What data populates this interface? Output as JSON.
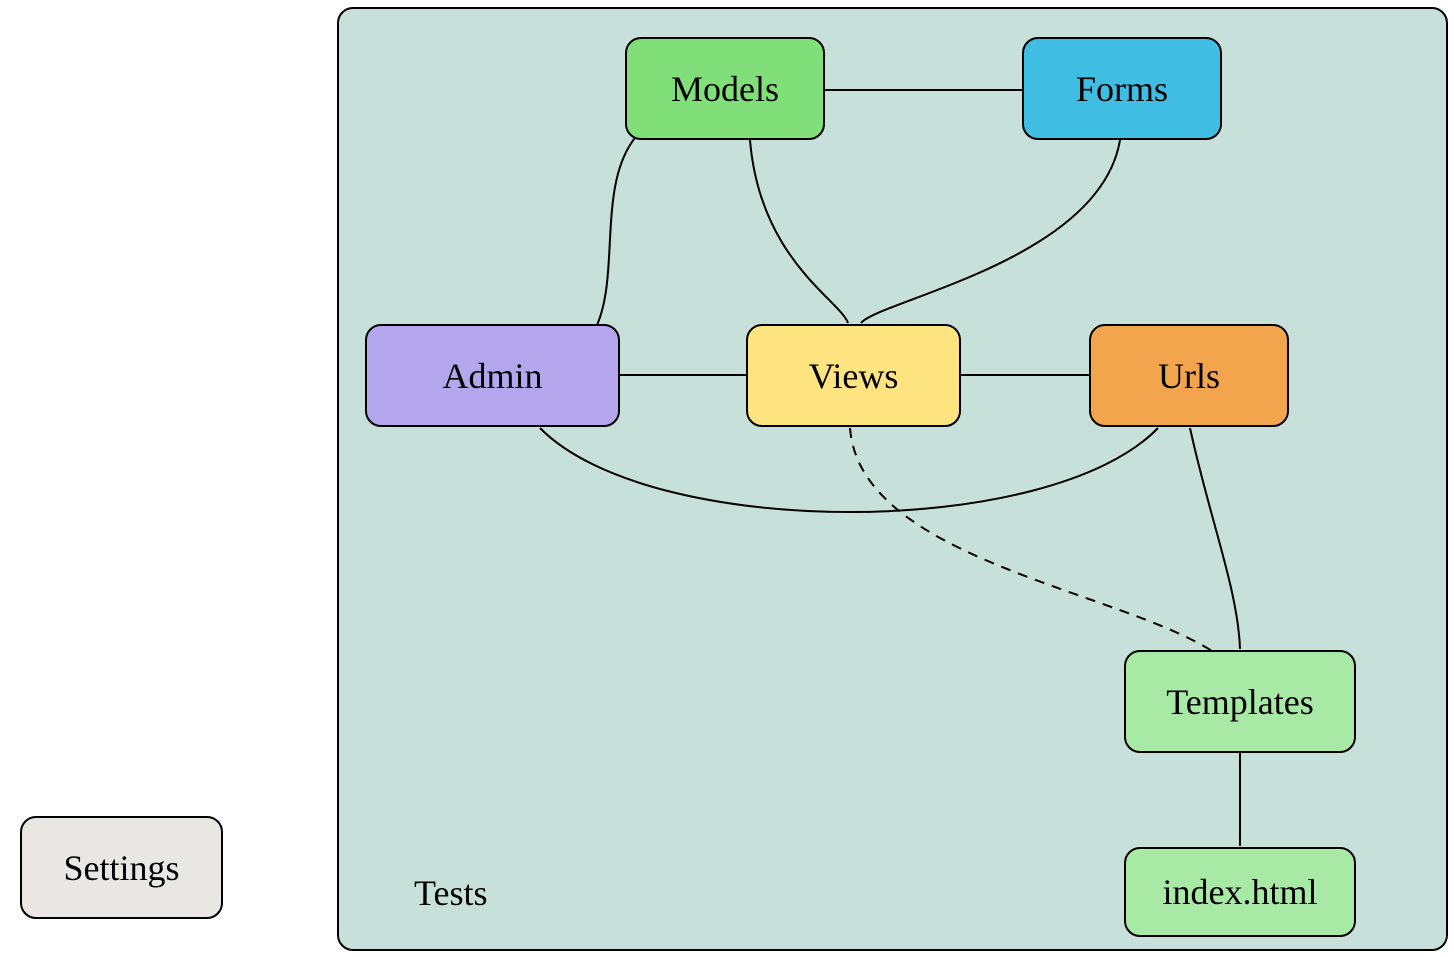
{
  "diagram": {
    "container": {
      "label": "Tests",
      "bg": "#c7e0da"
    },
    "nodes": {
      "settings": {
        "label": "Settings",
        "bg": "#e8e7e4"
      },
      "models": {
        "label": "Models",
        "bg": "#81df79"
      },
      "forms": {
        "label": "Forms",
        "bg": "#40bde3"
      },
      "admin": {
        "label": "Admin",
        "bg": "#b3a6ed"
      },
      "views": {
        "label": "Views",
        "bg": "#fee481"
      },
      "urls": {
        "label": "Urls",
        "bg": "#f2a54c"
      },
      "templates": {
        "label": "Templates",
        "bg": "#a8e9a6"
      },
      "indexhtml": {
        "label": "index.html",
        "bg": "#a8e9a6"
      }
    }
  }
}
